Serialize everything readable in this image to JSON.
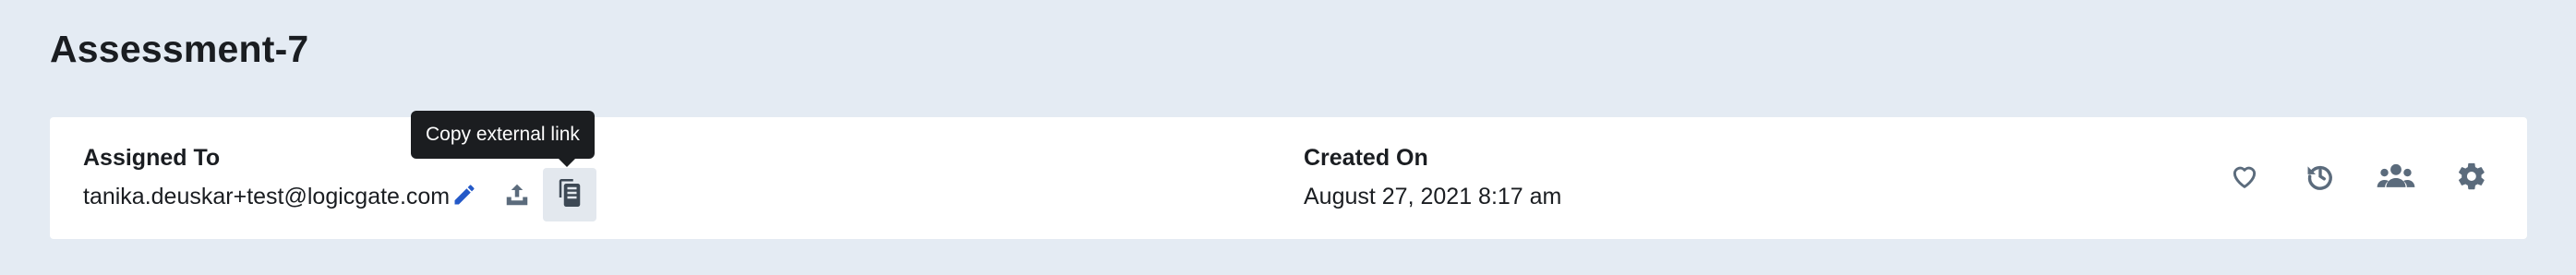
{
  "page": {
    "title": "Assessment-7"
  },
  "record": {
    "assigned_to_label": "Assigned To",
    "assigned_to_value": "tanika.deuskar+test@logicgate.com",
    "created_on_label": "Created On",
    "created_on_value": "August 27, 2021 8:17 am"
  },
  "tooltip": {
    "text": "Copy external link"
  },
  "icons": {
    "edit": "pencil-icon",
    "upload": "upload-icon",
    "copy": "copy-icon",
    "favorite": "heart-icon",
    "history": "history-icon",
    "users": "users-icon",
    "settings": "gear-icon"
  },
  "colors": {
    "background": "#e4ebf3",
    "card": "#ffffff",
    "edit_icon": "#2459c8",
    "muted_icon": "#5b6b7c",
    "tooltip_bg": "#1b1d20"
  }
}
